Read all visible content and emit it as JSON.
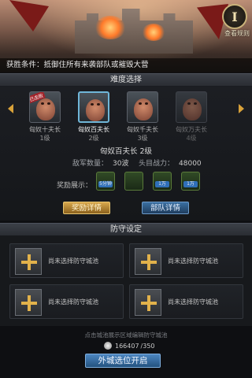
{
  "banner": {
    "round_button_glyph": "I",
    "round_button_label": "查看规则",
    "victory_text": "获胜条件：抵御住所有来袭部队或摧毁大营"
  },
  "difficulty": {
    "header": "难度选择",
    "enemies": [
      {
        "name": "匈奴十夫长",
        "level": "1级",
        "stamp": "已击败",
        "selected": false,
        "dim": false
      },
      {
        "name": "匈奴百夫长",
        "level": "2级",
        "stamp": "",
        "selected": true,
        "dim": false
      },
      {
        "name": "匈奴千夫长",
        "level": "3级",
        "stamp": "",
        "selected": false,
        "dim": false
      },
      {
        "name": "匈奴万夫长",
        "level": "4级",
        "stamp": "",
        "selected": false,
        "dim": true
      }
    ],
    "detail_title": "匈奴百夫长  2级",
    "enemy_count_label": "敌军数量：",
    "enemy_count_value": "30波",
    "leader_power_label": "头目战力：",
    "leader_power_value": "48000",
    "reward_label": "奖励展示：",
    "rewards": [
      {
        "icon": "speedup-icon",
        "badge": "5分钟"
      },
      {
        "icon": "tool-icon",
        "badge": ""
      },
      {
        "icon": "resource-icon",
        "badge": "1万"
      },
      {
        "icon": "resource-icon",
        "badge": "1万"
      }
    ],
    "reward_detail_button": "奖励详情",
    "troop_detail_button": "部队详情"
  },
  "defense": {
    "header": "防守设定",
    "slots": [
      {
        "text": "尚未选择防守城池"
      },
      {
        "text": "尚未选择防守城池"
      },
      {
        "text": "尚未选择防守城池"
      },
      {
        "text": "尚未选择防守城池"
      }
    ],
    "hint": "点击城池展示区域编辑防守城池",
    "coin_value": "166407",
    "coin_total": "/350",
    "start_button": "外城选位开启"
  },
  "colors": {
    "accent_gold": "#d9a23a",
    "accent_blue": "#3a6fa2",
    "plus_gold": "#e2b24b",
    "selected_border": "#6fb6d8"
  }
}
